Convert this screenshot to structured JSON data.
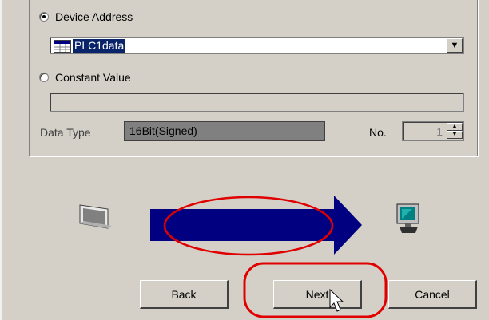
{
  "source": {
    "device_address_label": "Device Address",
    "device_address_value": "PLC1data",
    "constant_value_label": "Constant Value",
    "constant_value": "",
    "data_type_label": "Data Type",
    "data_type_value": "16Bit(Signed)",
    "no_label": "No.",
    "no_value": "1",
    "selected": "device_address"
  },
  "transfer": {
    "from_icon": "display-panel-icon",
    "arrow_icon": "transfer-arrow-icon",
    "to_icon": "computer-monitor-icon"
  },
  "buttons": {
    "back": "Back",
    "next": "Next",
    "cancel": "Cancel"
  },
  "highlight_color": "#e00000",
  "arrow_color": "#000080"
}
